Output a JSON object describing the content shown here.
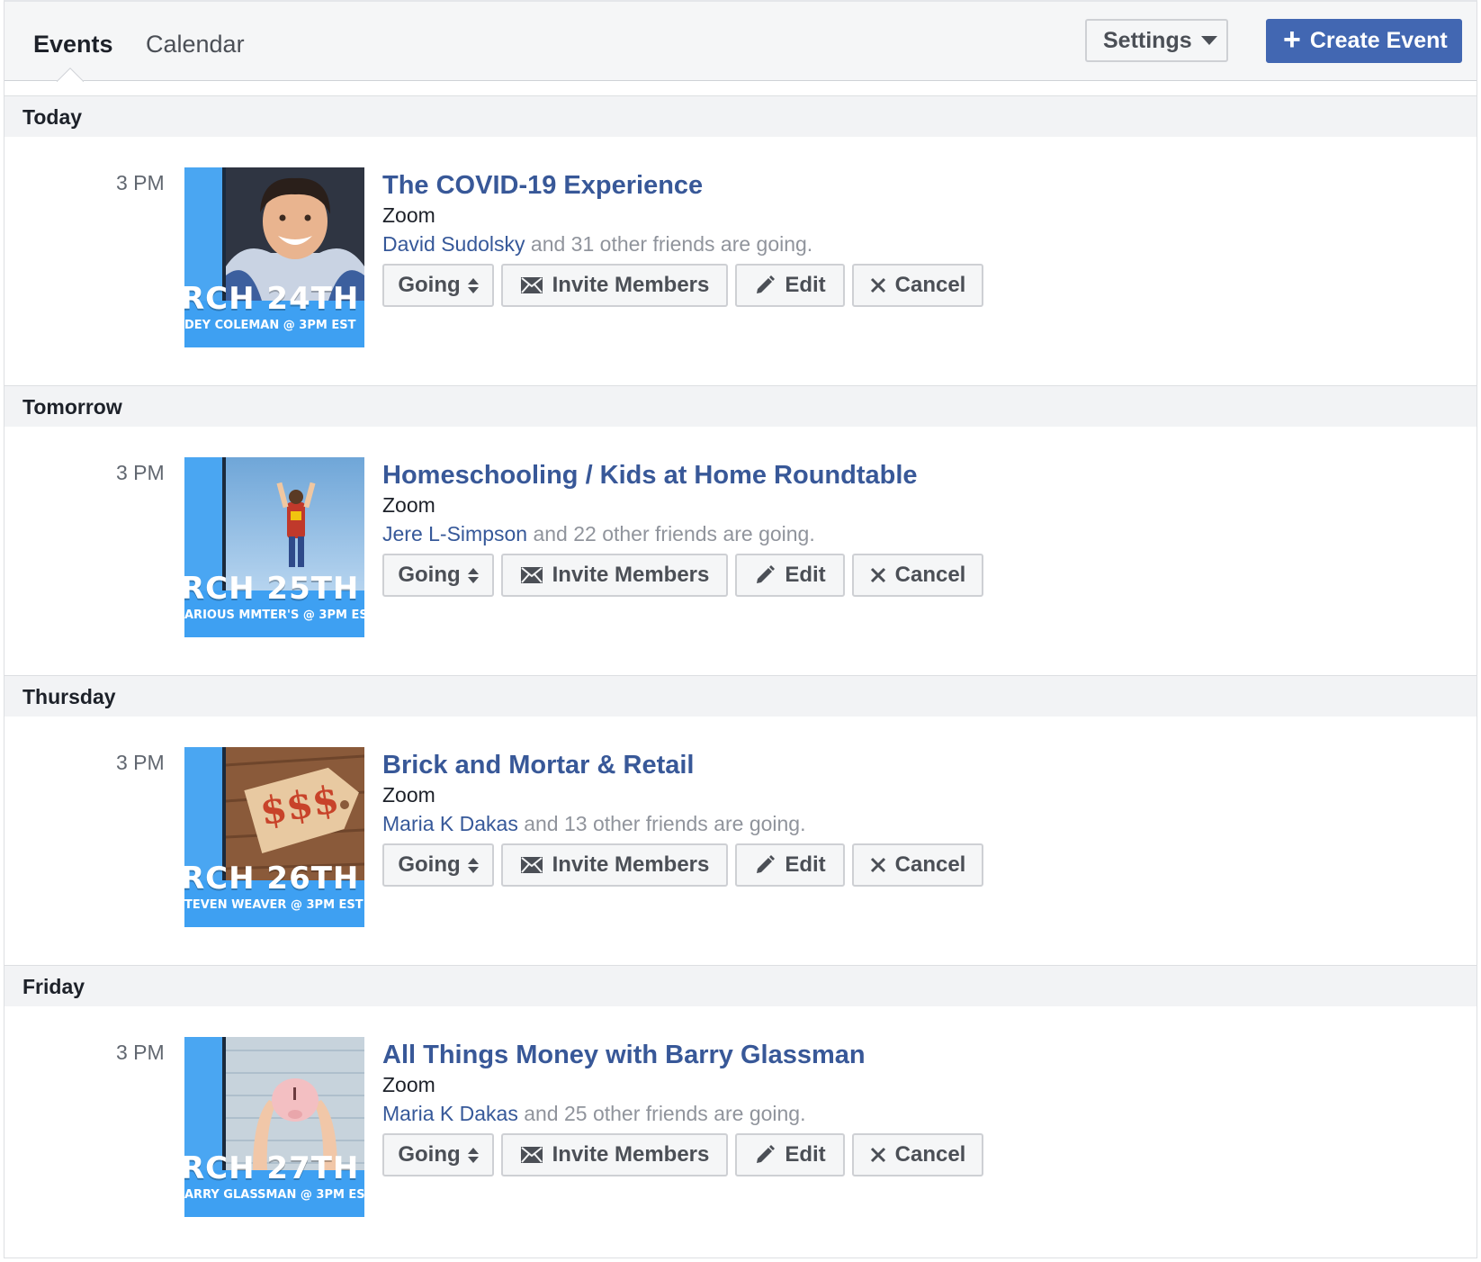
{
  "tabs": {
    "events": "Events",
    "calendar": "Calendar"
  },
  "toolbar": {
    "settings_label": "Settings",
    "create_label": "Create Event",
    "create_plus": "+"
  },
  "actions": {
    "going": "Going",
    "invite": "Invite Members",
    "edit": "Edit",
    "cancel": "Cancel"
  },
  "sections": [
    {
      "day": "Today",
      "event": {
        "time": "3 PM",
        "title": "The COVID-19 Experience",
        "location": "Zoom",
        "friend": "David Sudolsky",
        "friends_rest": " and 31 other friends are going.",
        "thumb_big": "RCH 24TH",
        "thumb_small": "DEY COLEMAN @ 3PM EST"
      }
    },
    {
      "day": "Tomorrow",
      "event": {
        "time": "3 PM",
        "title": "Homeschooling / Kids at Home Roundtable",
        "location": "Zoom",
        "friend": "Jere L-Simpson",
        "friends_rest": " and 22 other friends are going.",
        "thumb_big": "RCH 25TH",
        "thumb_small": "ARIOUS MMTER'S @ 3PM ES"
      }
    },
    {
      "day": "Thursday",
      "event": {
        "time": "3 PM",
        "title": "Brick and Mortar & Retail",
        "location": "Zoom",
        "friend": "Maria K Dakas",
        "friends_rest": " and 13 other friends are going.",
        "thumb_big": "RCH 26TH",
        "thumb_small": "TEVEN WEAVER @ 3PM EST",
        "thumb_tag": "$$$"
      }
    },
    {
      "day": "Friday",
      "event": {
        "time": "3 PM",
        "title": "All Things Money with Barry Glassman",
        "location": "Zoom",
        "friend": "Maria K Dakas",
        "friends_rest": " and 25 other friends are going.",
        "thumb_big": "RCH 27TH",
        "thumb_small": "ARRY GLASSMAN @ 3PM ES"
      }
    }
  ],
  "colors": {
    "accent": "#4267b2",
    "link": "#385898",
    "thumb_blue": "#3ea0f2"
  }
}
